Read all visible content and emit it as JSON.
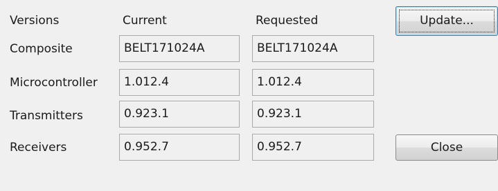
{
  "headers": {
    "versions": "Versions",
    "current": "Current",
    "requested": "Requested"
  },
  "rows": [
    {
      "label": "Composite",
      "current": "BELT171024A",
      "requested": "BELT171024A"
    },
    {
      "label": "Microcontroller",
      "current": "1.012.4",
      "requested": "1.012.4"
    },
    {
      "label": "Transmitters",
      "current": "0.923.1",
      "requested": "0.923.1"
    },
    {
      "label": "Receivers",
      "current": "0.952.7",
      "requested": "0.952.7"
    }
  ],
  "buttons": {
    "update_label": "Update...",
    "close_label": "Close"
  },
  "colors": {
    "background": "#f0f0f0",
    "field_border": "#a9a9a9",
    "default_button_border": "#3c7fb1"
  }
}
